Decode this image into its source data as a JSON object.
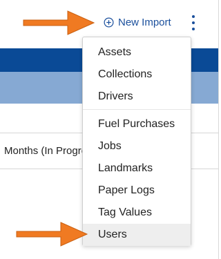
{
  "toolbar": {
    "new_import_label": "New Import",
    "new_import_icon": "plus-circle-icon",
    "more_icon": "kebab-menu-icon",
    "accent_color": "#1a4f9c"
  },
  "background_table": {
    "header_color": "#0a4a96",
    "subheader_color": "#86a9d3",
    "row_text": "Months (In Progres"
  },
  "menu": {
    "items": [
      {
        "label": "Assets"
      },
      {
        "label": "Collections"
      },
      {
        "label": "Drivers"
      },
      {
        "label": "Fuel Purchases"
      },
      {
        "label": "Jobs"
      },
      {
        "label": "Landmarks"
      },
      {
        "label": "Paper Logs"
      },
      {
        "label": "Tag Values"
      },
      {
        "label": "Users",
        "highlighted": true
      }
    ]
  },
  "annotations": {
    "arrow_color": "#f07a22",
    "arrow_icon": "orange-arrow-icon"
  }
}
